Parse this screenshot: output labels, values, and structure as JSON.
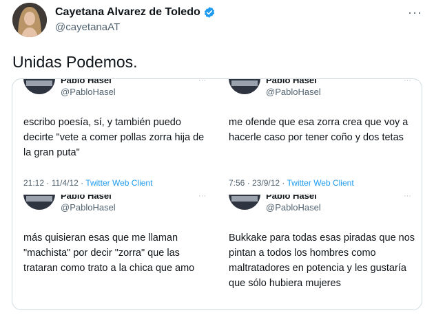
{
  "author": {
    "name": "Cayetana Alvarez de Toledo",
    "handle": "@cayetanaAT",
    "verified_color": "#1d9bf0"
  },
  "tweet": {
    "text": "Unidas Podemos."
  },
  "more_icon": "more-horizontal-icon",
  "embedded_tweets": [
    {
      "name": "Pablo Hasel",
      "handle": "@PabloHasel",
      "text": "escribo poesía, sí, y también puedo decirte \"vete a comer pollas zorra hija de la gran puta\"",
      "time": "21:12 · 11/4/12 · ",
      "client": "Twitter Web Client"
    },
    {
      "name": "Pablo Hasel",
      "handle": "@PabloHasel",
      "text": "me ofende que esa zorra crea que voy a hacerle caso por tener coño y dos tetas",
      "time": "7:56 · 23/9/12 · ",
      "client": "Twitter Web Client"
    },
    {
      "name": "Pablo Hasel",
      "handle": "@PabloHasel",
      "text": "más quisieran esas que me llaman \"machista\" por decir \"zorra\" que las trataran como trato a la chica que amo",
      "time": "",
      "client": ""
    },
    {
      "name": "Pablo Hasel",
      "handle": "@PabloHasel",
      "text": "Bukkake para todas esas piradas que nos pintan a todos los hombres como maltratadores en potencia y les gustaría que sólo hubiera mujeres",
      "time": "",
      "client": ""
    }
  ]
}
